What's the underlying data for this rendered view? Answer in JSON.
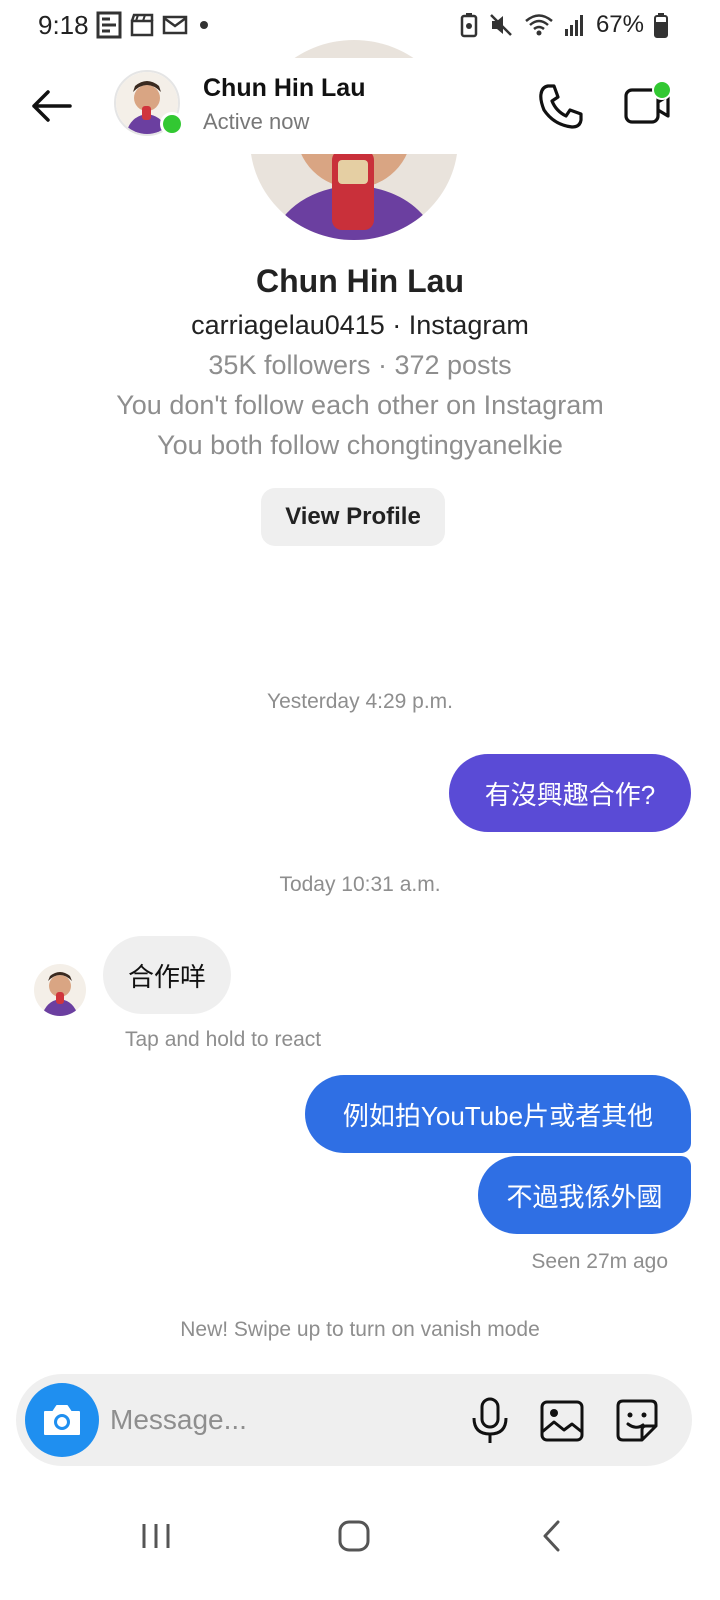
{
  "status_bar": {
    "time": "9:18",
    "battery": "67%",
    "notification_icons": [
      "e-icon",
      "clapper-icon",
      "mail-icon",
      "dot-icon"
    ],
    "system_icons": [
      "battery-saver-icon",
      "mute-icon",
      "wifi-icon",
      "signal-icon",
      "battery-icon"
    ]
  },
  "header": {
    "name": "Chun Hin Lau",
    "status": "Active now",
    "online_color": "#32c832"
  },
  "profile": {
    "name": "Chun Hin Lau",
    "handle_line": "carriagelau0415 · Instagram",
    "followers_line": "35K followers · 372 posts",
    "relation_line": "You don't follow each other on Instagram",
    "mutual_line": "You both follow chongtingyanelkie",
    "view_profile": "View Profile"
  },
  "messages": {
    "timestamp_1": "Yesterday 4:29 p.m.",
    "out_1": "有沒興趣合作?",
    "timestamp_2": "Today 10:31 a.m.",
    "in_1": "合作咩",
    "react_hint": "Tap and hold to react",
    "out_2": "例如拍YouTube片或者其他",
    "out_3": "不過我係外國",
    "seen": "Seen 27m ago",
    "vanish_hint": "New! Swipe up to turn on vanish mode"
  },
  "composer": {
    "placeholder": "Message..."
  },
  "colors": {
    "bubble_out_purple": "#5a4bd6",
    "bubble_out_blue": "#2f6fe4",
    "bubble_in": "#efefef",
    "camera_button": "#1f8ff0"
  }
}
